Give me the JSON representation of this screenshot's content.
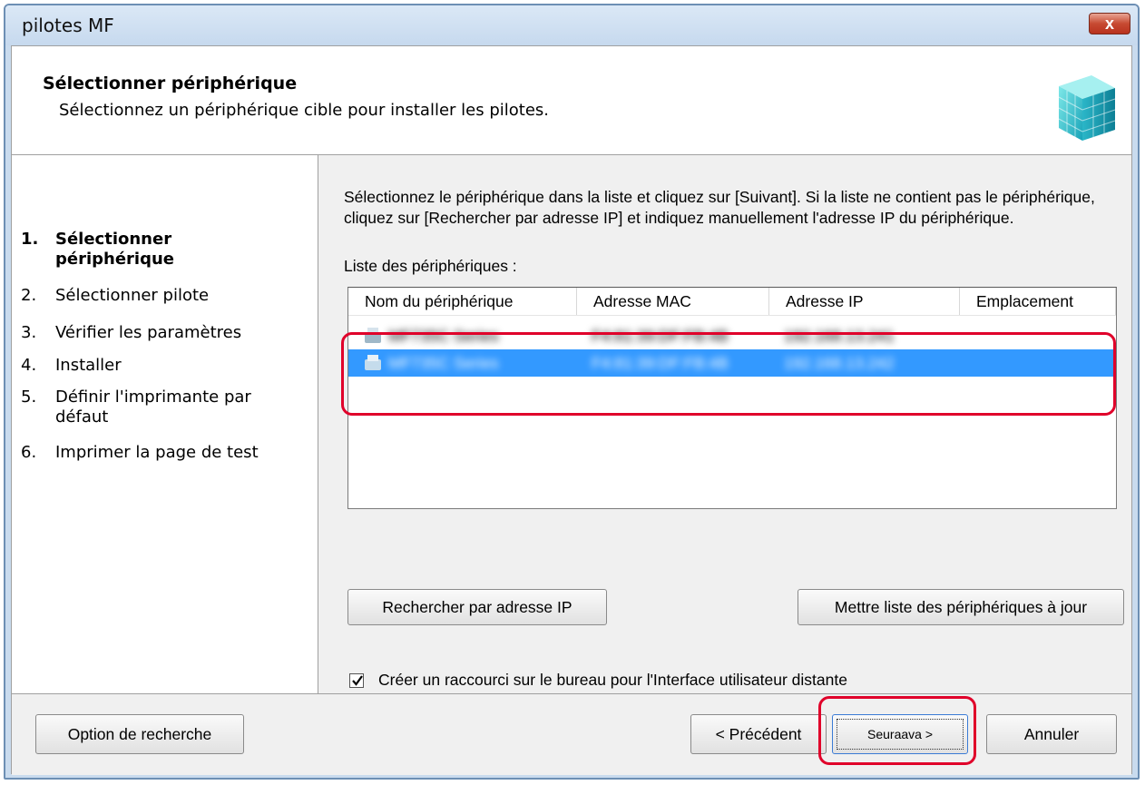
{
  "window": {
    "title": "pilotes MF",
    "close_label": "x"
  },
  "header": {
    "title": "Sélectionner périphérique",
    "subtitle": "Sélectionnez un périphérique cible pour installer les pilotes."
  },
  "steps": [
    {
      "num": "1.",
      "label": "Sélectionner périphérique",
      "active": true
    },
    {
      "num": "2.",
      "label": "Sélectionner pilote"
    },
    {
      "num": "3.",
      "label": "Vérifier les paramètres"
    },
    {
      "num": "4.",
      "label": "Installer"
    },
    {
      "num": "5.",
      "label": "Définir l'imprimante par défaut"
    },
    {
      "num": "6.",
      "label": "Imprimer la page de test"
    }
  ],
  "main": {
    "instructions": "Sélectionnez le périphérique dans la liste et cliquez sur [Suivant]. Si la liste ne contient pas le périphérique, cliquez sur [Rechercher par adresse IP] et indiquez manuellement l'adresse IP du périphérique.",
    "list_label": "Liste des périphériques :",
    "columns": [
      "Nom du périphérique",
      "Adresse MAC",
      "Adresse IP",
      "Emplacement"
    ],
    "rows": [
      {
        "name": "MF735C Series",
        "mac": "F4:81:39:DF:FB:4B",
        "ip": "192.168.13.241",
        "selected": false
      },
      {
        "name": "MF735C Series",
        "mac": "F4:81:39:DF:FB:4B",
        "ip": "192.168.13.242",
        "selected": true
      }
    ],
    "search_ip_button": "Rechercher par adresse IP",
    "refresh_button": "Mettre liste des périphériques à jour",
    "shortcut_checkbox": {
      "label": "Créer un raccourci sur le bureau pour l'Interface utilisateur distante",
      "checked": true
    }
  },
  "footer": {
    "search_option_button": "Option de recherche",
    "back_button": "< Précédent",
    "next_button": "Seuraava >",
    "cancel_button": "Annuler"
  },
  "colors": {
    "highlight": "#e0002a",
    "selection": "#3399ff"
  }
}
